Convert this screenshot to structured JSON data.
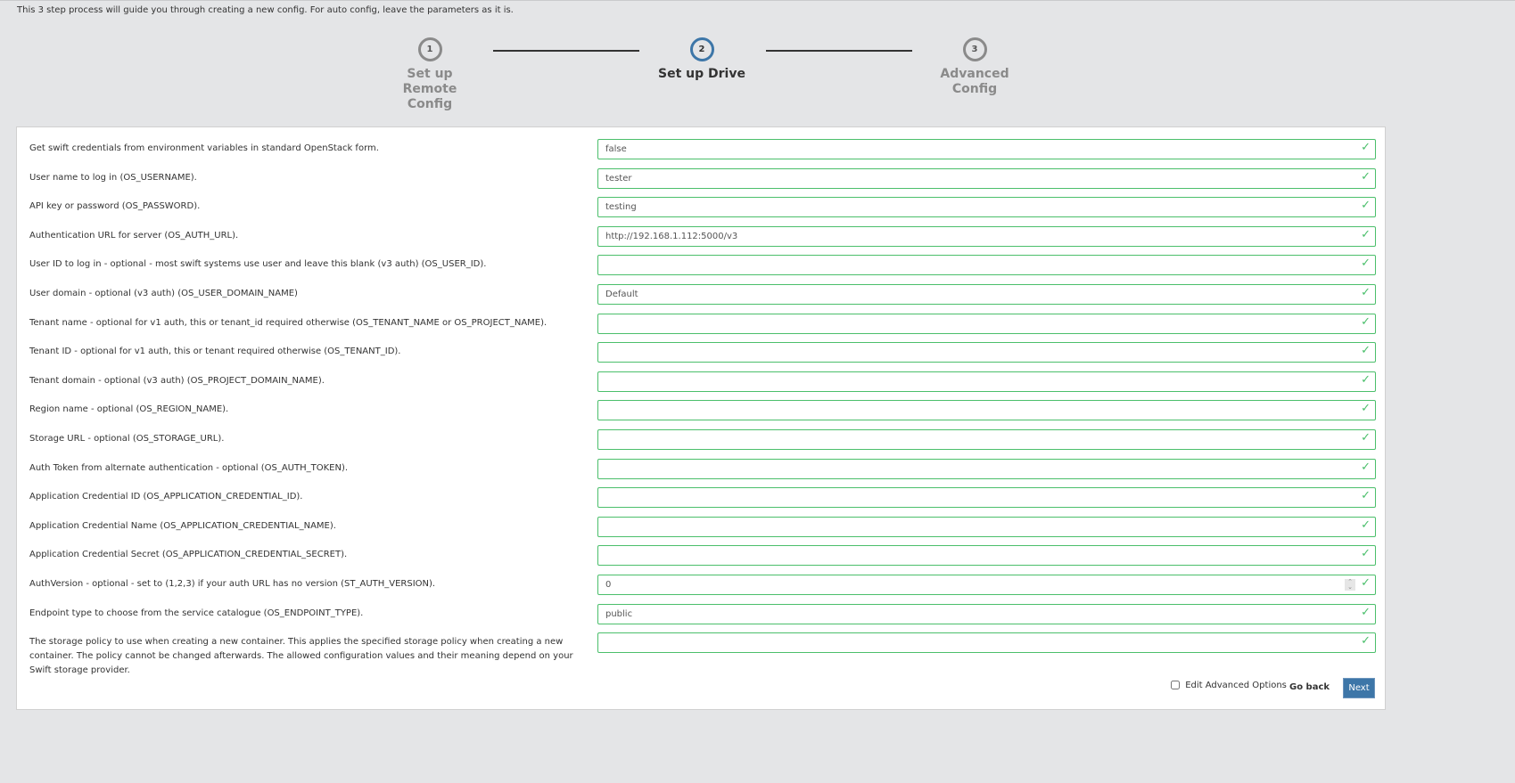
{
  "intro": "This 3 step process will guide you through creating a new config. For auto config, leave the parameters as it is.",
  "steps": [
    {
      "num": "1",
      "label": "Set up Remote Config"
    },
    {
      "num": "2",
      "label": "Set up Drive"
    },
    {
      "num": "3",
      "label": "Advanced Config"
    }
  ],
  "fields": [
    {
      "label": "Get swift credentials from environment variables in standard OpenStack form.",
      "value": "false"
    },
    {
      "label": "User name to log in (OS_USERNAME).",
      "value": "tester"
    },
    {
      "label": "API key or password (OS_PASSWORD).",
      "value": "testing"
    },
    {
      "label": "Authentication URL for server (OS_AUTH_URL).",
      "value": "http://192.168.1.112:5000/v3"
    },
    {
      "label": "User ID to log in - optional - most swift systems use user and leave this blank (v3 auth) (OS_USER_ID).",
      "value": ""
    },
    {
      "label": "User domain - optional (v3 auth) (OS_USER_DOMAIN_NAME)",
      "value": "Default"
    },
    {
      "label": "Tenant name - optional for v1 auth, this or tenant_id required otherwise (OS_TENANT_NAME or OS_PROJECT_NAME).",
      "value": ""
    },
    {
      "label": "Tenant ID - optional for v1 auth, this or tenant required otherwise (OS_TENANT_ID).",
      "value": ""
    },
    {
      "label": "Tenant domain - optional (v3 auth) (OS_PROJECT_DOMAIN_NAME).",
      "value": ""
    },
    {
      "label": "Region name - optional (OS_REGION_NAME).",
      "value": ""
    },
    {
      "label": "Storage URL - optional (OS_STORAGE_URL).",
      "value": ""
    },
    {
      "label": "Auth Token from alternate authentication - optional (OS_AUTH_TOKEN).",
      "value": ""
    },
    {
      "label": "Application Credential ID (OS_APPLICATION_CREDENTIAL_ID).",
      "value": ""
    },
    {
      "label": "Application Credential Name (OS_APPLICATION_CREDENTIAL_NAME).",
      "value": ""
    },
    {
      "label": "Application Credential Secret (OS_APPLICATION_CREDENTIAL_SECRET).",
      "value": ""
    },
    {
      "label": "AuthVersion - optional - set to (1,2,3) if your auth URL has no version (ST_AUTH_VERSION).",
      "value": "0",
      "number": true
    },
    {
      "label": "Endpoint type to choose from the service catalogue (OS_ENDPOINT_TYPE).",
      "value": "public"
    },
    {
      "label": "The storage policy to use when creating a new container. This applies the specified storage policy when creating a new container. The policy cannot be changed afterwards. The allowed configuration values and their meaning depend on your Swift storage provider.",
      "value": ""
    }
  ],
  "footer": {
    "advanced_label": "Edit Advanced Options",
    "back_label": "Go back",
    "next_label": "Next"
  },
  "colors": {
    "accent": "#3d76a8",
    "valid": "#4bbf6b"
  }
}
